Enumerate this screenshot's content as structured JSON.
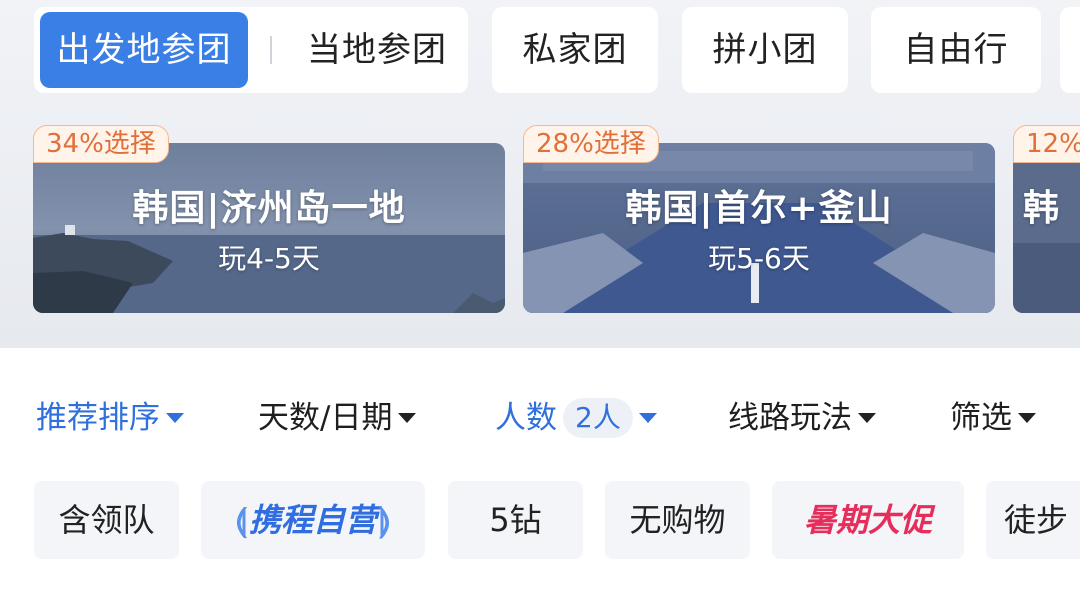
{
  "tabs": {
    "active": "出发地参团",
    "local": "当地参团",
    "private": "私家团",
    "small": "拼小团",
    "free": "自由行"
  },
  "destinations": [
    {
      "badge": "34%选择",
      "title": "韩国|济州岛一地",
      "subtitle": "玩4-5天"
    },
    {
      "badge": "28%选择",
      "title": "韩国|首尔+釜山",
      "subtitle": "玩5-6天"
    },
    {
      "badge": "12%",
      "title": "韩"
    }
  ],
  "sort": {
    "recommend": "推荐排序",
    "days": "天数/日期",
    "people": "人数",
    "people_value": "2人",
    "route": "线路玩法",
    "filter": "筛选"
  },
  "chips": {
    "leader": "含领队",
    "ctrip": "携程自营",
    "diamond": "5钻",
    "noshop": "无购物",
    "promo": "暑期大促",
    "hiking": "徒步"
  },
  "colors": {
    "accent": "#3a7fe6",
    "link_blue": "#3070dd",
    "promo_red": "#e62e5c",
    "badge_orange": "#e0703a"
  }
}
